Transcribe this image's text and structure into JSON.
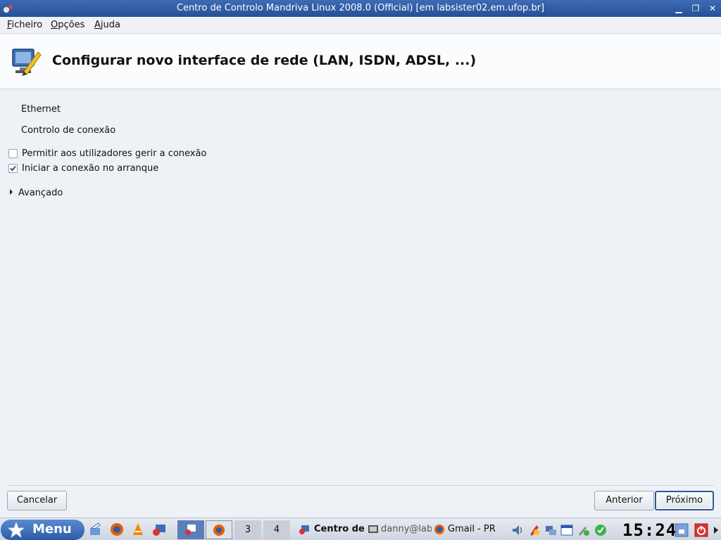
{
  "window": {
    "title": "Centro de Controlo Mandriva Linux 2008.0 (Official) [em labsister02.em.ufop.br]"
  },
  "menubar": {
    "items": [
      "Ficheiro",
      "Opções",
      "Ajuda"
    ]
  },
  "header": {
    "title": "Configurar novo interface de rede (LAN, ISDN, ADSL, ...)"
  },
  "content": {
    "section1": "Ethernet",
    "section2": "Controlo de conexão",
    "checkbox_users": {
      "label": "Permitir aos utilizadores gerir a conexão",
      "checked": false
    },
    "checkbox_boot": {
      "label": "Iniciar a conexão no arranque",
      "checked": true
    },
    "expander": "Avançado"
  },
  "buttons": {
    "cancel": "Cancelar",
    "previous": "Anterior",
    "next": "Próximo"
  },
  "taskbar": {
    "menu_label": "Menu",
    "desktops": [
      "3",
      "4"
    ],
    "tasks": [
      "Centro de",
      "danny@lab",
      "Gmail - PR"
    ],
    "clock": "15:24"
  },
  "colors": {
    "titlebar": "#274f95",
    "background": "#eef1f6",
    "default_button_border": "#2f5797"
  }
}
